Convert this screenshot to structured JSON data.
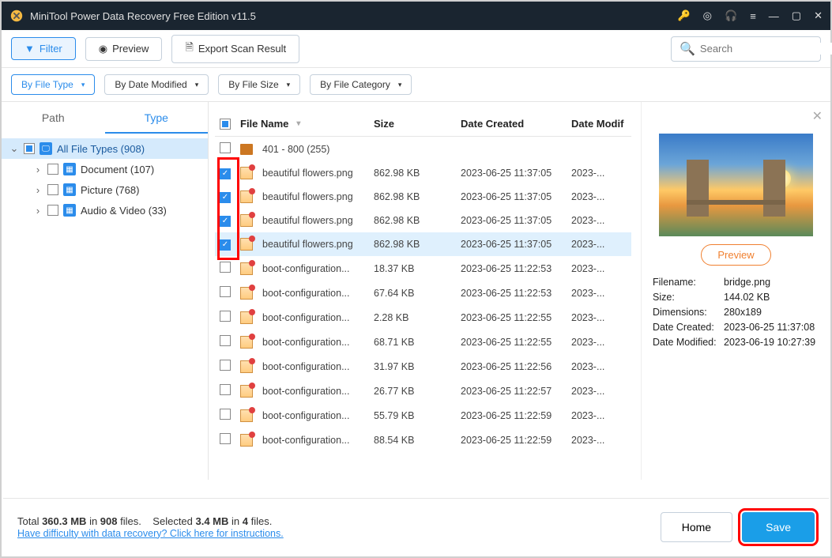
{
  "title": "MiniTool Power Data Recovery Free Edition v11.5",
  "toolbar": {
    "filter": "Filter",
    "preview": "Preview",
    "export": "Export Scan Result",
    "search_placeholder": "Search"
  },
  "filterbar": {
    "byType": "By File Type",
    "byDate": "By Date Modified",
    "bySize": "By File Size",
    "byCategory": "By File Category"
  },
  "tabs": {
    "path": "Path",
    "type": "Type"
  },
  "tree": {
    "root": "All File Types (908)",
    "children": [
      {
        "label": "Document (107)",
        "ic": "ic-doc"
      },
      {
        "label": "Picture (768)",
        "ic": "ic-pic"
      },
      {
        "label": "Audio & Video (33)",
        "ic": "ic-av"
      }
    ]
  },
  "columns": {
    "name": "File Name",
    "size": "Size",
    "created": "Date Created",
    "modified": "Date Modif"
  },
  "folderRow": {
    "name": "401 - 800 (255)"
  },
  "files": [
    {
      "chk": true,
      "name": "beautiful flowers.png",
      "size": "862.98 KB",
      "created": "2023-06-25 11:37:05",
      "modified": "2023-...",
      "sel": false
    },
    {
      "chk": true,
      "name": "beautiful flowers.png",
      "size": "862.98 KB",
      "created": "2023-06-25 11:37:05",
      "modified": "2023-...",
      "sel": false
    },
    {
      "chk": true,
      "name": "beautiful flowers.png",
      "size": "862.98 KB",
      "created": "2023-06-25 11:37:05",
      "modified": "2023-...",
      "sel": false
    },
    {
      "chk": true,
      "name": "beautiful flowers.png",
      "size": "862.98 KB",
      "created": "2023-06-25 11:37:05",
      "modified": "2023-...",
      "sel": true
    },
    {
      "chk": false,
      "name": "boot-configuration...",
      "size": "18.37 KB",
      "created": "2023-06-25 11:22:53",
      "modified": "2023-...",
      "sel": false
    },
    {
      "chk": false,
      "name": "boot-configuration...",
      "size": "67.64 KB",
      "created": "2023-06-25 11:22:53",
      "modified": "2023-...",
      "sel": false
    },
    {
      "chk": false,
      "name": "boot-configuration...",
      "size": "2.28 KB",
      "created": "2023-06-25 11:22:55",
      "modified": "2023-...",
      "sel": false
    },
    {
      "chk": false,
      "name": "boot-configuration...",
      "size": "68.71 KB",
      "created": "2023-06-25 11:22:55",
      "modified": "2023-...",
      "sel": false
    },
    {
      "chk": false,
      "name": "boot-configuration...",
      "size": "31.97 KB",
      "created": "2023-06-25 11:22:56",
      "modified": "2023-...",
      "sel": false
    },
    {
      "chk": false,
      "name": "boot-configuration...",
      "size": "26.77 KB",
      "created": "2023-06-25 11:22:57",
      "modified": "2023-...",
      "sel": false
    },
    {
      "chk": false,
      "name": "boot-configuration...",
      "size": "55.79 KB",
      "created": "2023-06-25 11:22:59",
      "modified": "2023-...",
      "sel": false
    },
    {
      "chk": false,
      "name": "boot-configuration...",
      "size": "88.54 KB",
      "created": "2023-06-25 11:22:59",
      "modified": "2023-...",
      "sel": false
    }
  ],
  "preview": {
    "button": "Preview",
    "meta": {
      "filename_k": "Filename:",
      "filename_v": "bridge.png",
      "size_k": "Size:",
      "size_v": "144.02 KB",
      "dim_k": "Dimensions:",
      "dim_v": "280x189",
      "created_k": "Date Created:",
      "created_v": "2023-06-25 11:37:08",
      "modified_k": "Date Modified:",
      "modified_v": "2023-06-19 10:27:39"
    }
  },
  "footer": {
    "total_prefix": "Total ",
    "total_size": "360.3 MB",
    "total_mid": " in ",
    "total_files": "908",
    "total_suffix": " files.",
    "sel_prefix": "Selected ",
    "sel_size": "3.4 MB",
    "sel_mid": " in ",
    "sel_files": "4",
    "sel_suffix": " files.",
    "help": "Have difficulty with data recovery? Click here for instructions.",
    "home": "Home",
    "save": "Save"
  }
}
